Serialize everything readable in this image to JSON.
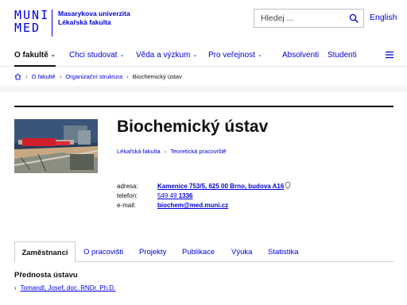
{
  "brand": {
    "line1": "MUNI",
    "line2": "MED",
    "university": "Masarykova univerzita",
    "faculty": "Lékařská fakulta"
  },
  "search": {
    "placeholder": "Hledej ..."
  },
  "language": "English",
  "nav": {
    "items": [
      {
        "label": "O fakultě",
        "has_menu": true,
        "active": true
      },
      {
        "label": "Chci studovat",
        "has_menu": true
      },
      {
        "label": "Věda a výzkum",
        "has_menu": true
      },
      {
        "label": "Pro veřejnost",
        "has_menu": true
      },
      {
        "label": "Absolventi"
      },
      {
        "label": "Studenti"
      }
    ]
  },
  "breadcrumb": {
    "items": [
      "O fakultě",
      "Organizační struktura"
    ],
    "current": "Biochemický ústav"
  },
  "department": {
    "title": "Biochemický ústav",
    "parents": [
      "Lékařská fakulta",
      "Teoretická pracoviště"
    ]
  },
  "contact": {
    "address_label": "adresa:",
    "address": "Kamenice 753/5, 625 00 Brno, budova A16",
    "phone_label": "telefon:",
    "phone_prefix": "549 49",
    "phone_ext": "1336",
    "email_label": "e-mail:",
    "email": "biochem@med.muni.cz"
  },
  "tabs": [
    "Zaměstnanci",
    "O pracovišti",
    "Projekty",
    "Publikace",
    "Výuka",
    "Statistika"
  ],
  "staff": {
    "section_title": "Přednosta ústavu",
    "head": "Tomandl, Josef, doc. RNDr. Ph.D."
  },
  "colors": {
    "accent": "#0000dc",
    "text": "#111111",
    "rule": "#111111"
  },
  "icons": [
    "search-icon",
    "chevron-down-icon",
    "menu-icon",
    "home-icon",
    "chevron-right-icon",
    "map-pin-icon"
  ]
}
